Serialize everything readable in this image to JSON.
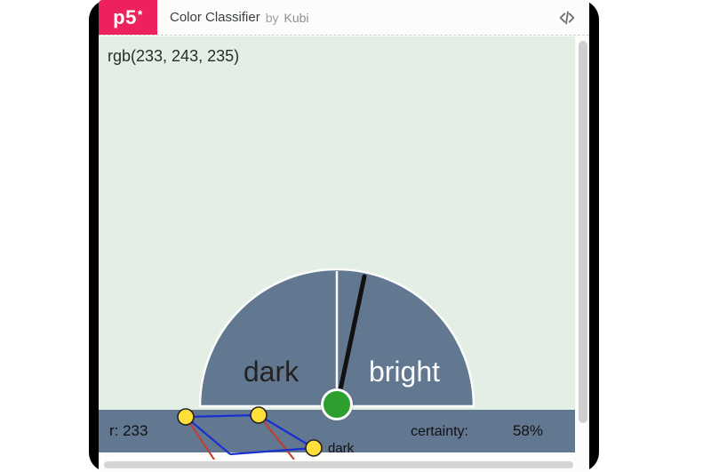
{
  "header": {
    "logo_text": "p5",
    "logo_star": "*",
    "title": "Color Classifier",
    "by": "by",
    "author": "Kubi"
  },
  "sketch": {
    "bg_rgb": "rgb(233, 243, 235)",
    "gauge": {
      "left_label": "dark",
      "right_label": "bright",
      "value_fraction": 0.58,
      "fill": "#627891",
      "outline": "#fcfcfc",
      "needle": "#111",
      "knob": "#2e9f2e"
    },
    "network": {
      "input_label": "r: 233",
      "prediction": "dark",
      "certainty_label": "certainty:",
      "certainty_value": "58%"
    }
  },
  "chart_data": {
    "type": "gauge",
    "title": "Color Classifier prediction",
    "categories": [
      "dark",
      "bright"
    ],
    "value": 0.58,
    "range": [
      0,
      1
    ],
    "note": "needle position mapped left=dark (0) to right=bright (1); certainty 58%"
  }
}
